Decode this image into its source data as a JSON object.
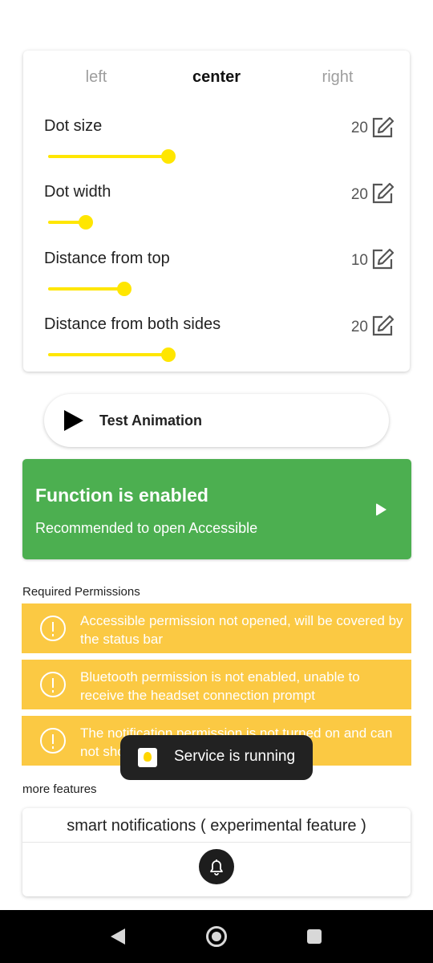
{
  "position_tabs": {
    "left": "left",
    "center": "center",
    "right": "right",
    "selected": "center"
  },
  "settings": [
    {
      "label": "Dot size",
      "value": "20",
      "slider_fraction": 0.74
    },
    {
      "label": "Dot width",
      "value": "20",
      "slider_fraction": 0.2
    },
    {
      "label": "Distance from top",
      "value": "10",
      "slider_fraction": 0.45
    },
    {
      "label": "Distance from both sides",
      "value": "20",
      "slider_fraction": 0.74
    }
  ],
  "test_button": {
    "label": "Test Animation",
    "icon": "play-icon"
  },
  "status_card": {
    "title": "Function is enabled",
    "subtitle": "Recommended to open Accessible",
    "color": "#4caf50"
  },
  "required_permissions": {
    "title": "Required Permissions",
    "items": [
      "Accessible permission not opened, will be covered by the status bar",
      "Bluetooth permission is not enabled, unable to receive the headset connection prompt",
      "The notification permission is not turned on and can not show notifications"
    ],
    "color": "#fbc943"
  },
  "toast": {
    "text": "Service is running"
  },
  "more_features": {
    "title": "more features",
    "smart_notifications": {
      "title": "smart notifications ( experimental feature )",
      "icon": "bell-icon"
    }
  },
  "accent_color": "#ffe600",
  "navbar": {
    "back": "back-icon",
    "home": "home-icon",
    "recent": "recent-apps-icon"
  }
}
